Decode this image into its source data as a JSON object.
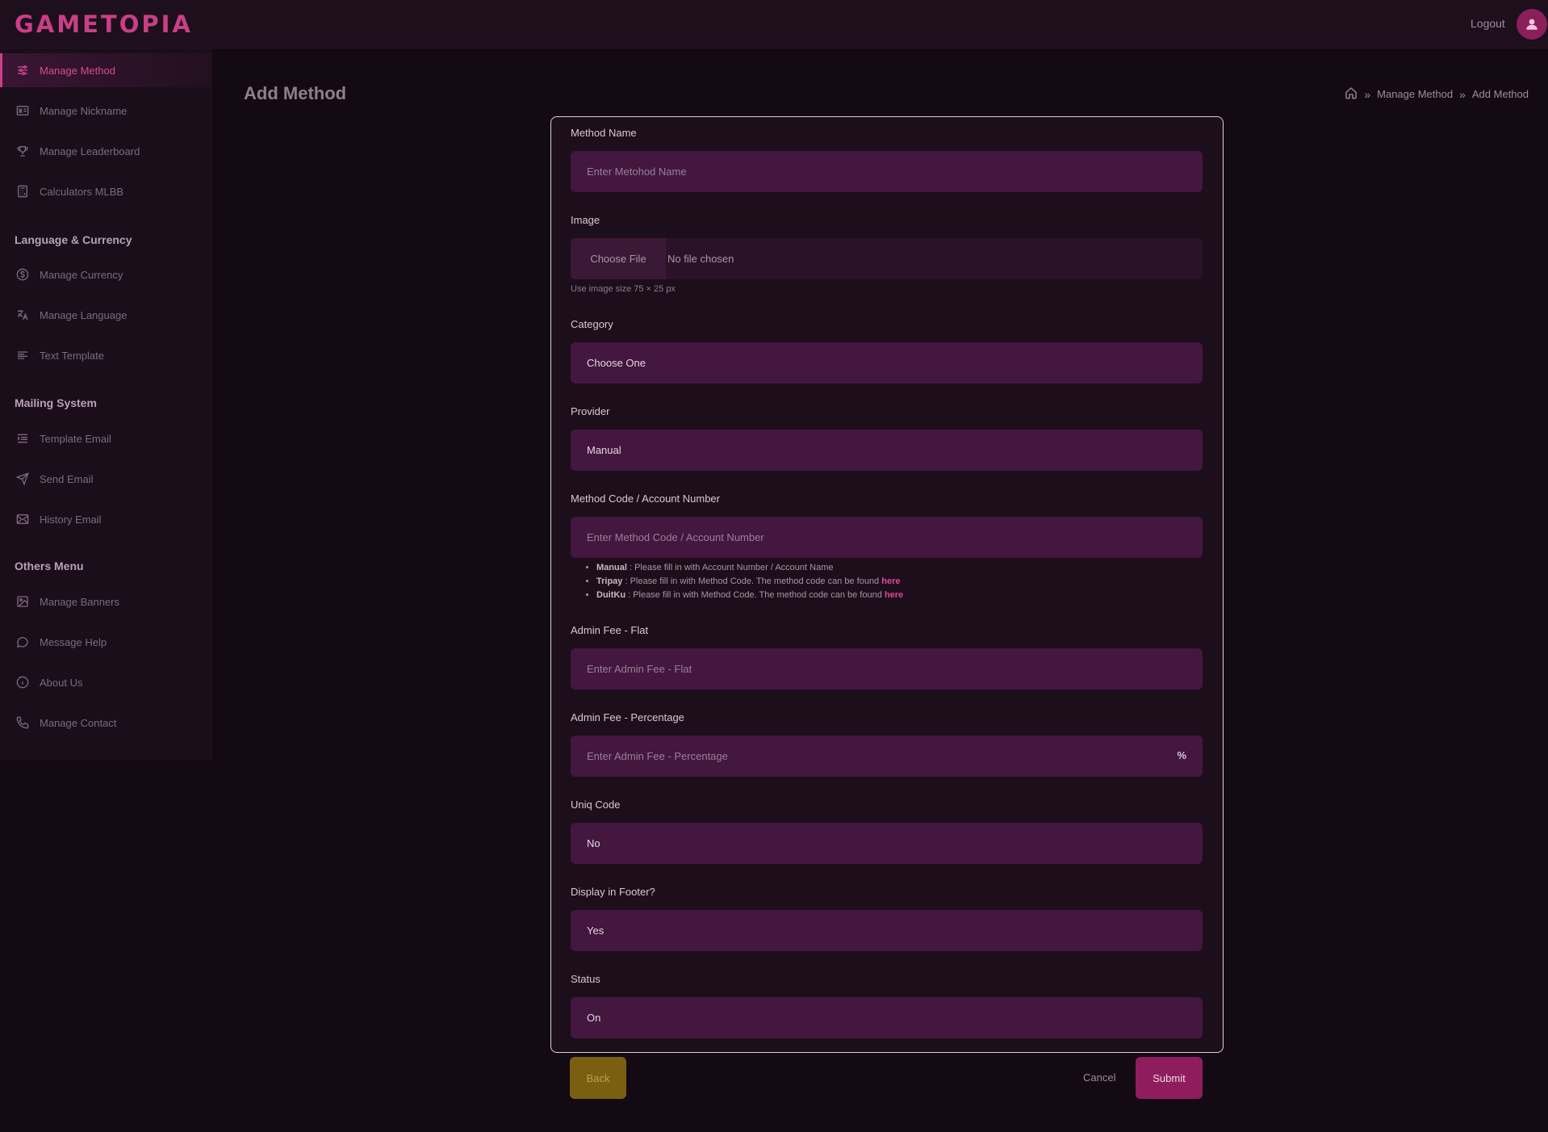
{
  "app": {
    "logo": "GAMETOPIA",
    "logout_label": "Logout"
  },
  "sidebar": {
    "items": [
      {
        "label": "Manage Method",
        "icon": "sliders-icon",
        "active": true
      },
      {
        "label": "Manage Nickname",
        "icon": "id-card-icon"
      },
      {
        "label": "Manage Leaderboard",
        "icon": "trophy-icon"
      },
      {
        "label": "Calculators MLBB",
        "icon": "calculator-icon"
      }
    ],
    "sections": [
      {
        "title": "Language & Currency",
        "items": [
          {
            "label": "Manage Currency",
            "icon": "dollar-circle-icon"
          },
          {
            "label": "Manage Language",
            "icon": "translate-icon"
          },
          {
            "label": "Text Template",
            "icon": "align-left-icon"
          }
        ]
      },
      {
        "title": "Mailing System",
        "items": [
          {
            "label": "Template Email",
            "icon": "list-indent-icon"
          },
          {
            "label": "Send Email",
            "icon": "send-icon"
          },
          {
            "label": "History Email",
            "icon": "envelope-icon"
          }
        ]
      },
      {
        "title": "Others Menu",
        "items": [
          {
            "label": "Manage Banners",
            "icon": "image-icon"
          },
          {
            "label": "Message Help",
            "icon": "chat-icon"
          },
          {
            "label": "About Us",
            "icon": "info-icon"
          },
          {
            "label": "Manage Contact",
            "icon": "phone-icon"
          }
        ]
      }
    ]
  },
  "page": {
    "title": "Add Method",
    "breadcrumb": [
      "Manage Method",
      "Add Method"
    ]
  },
  "form": {
    "method_name": {
      "label": "Method Name",
      "placeholder": "Enter Metohod Name"
    },
    "image": {
      "label": "Image",
      "button": "Choose File",
      "status": "No file chosen",
      "hint": "Use image size 75 × 25 px"
    },
    "category": {
      "label": "Category",
      "value": "Choose One"
    },
    "provider": {
      "label": "Provider",
      "value": "Manual"
    },
    "method_code": {
      "label": "Method Code / Account Number",
      "placeholder": "Enter Method Code / Account Number"
    },
    "notes": [
      {
        "name": "Manual",
        "text": " : Please fill in with Account Number / Account Name",
        "link": ""
      },
      {
        "name": "Tripay",
        "text": " : Please fill in with Method Code. The method code can be found ",
        "link": "here"
      },
      {
        "name": "DuitKu",
        "text": " : Please fill in with Method Code. The method code can be found ",
        "link": "here"
      }
    ],
    "admin_fee_flat": {
      "label": "Admin Fee - Flat",
      "placeholder": "Enter Admin Fee - Flat"
    },
    "admin_fee_percentage": {
      "label": "Admin Fee - Percentage",
      "placeholder": "Enter Admin Fee - Percentage",
      "suffix": "%"
    },
    "uniq_code": {
      "label": "Uniq Code",
      "value": "No"
    },
    "display_footer": {
      "label": "Display in Footer?",
      "value": "Yes"
    },
    "status": {
      "label": "Status",
      "value": "On"
    }
  },
  "actions": {
    "back": "Back",
    "cancel": "Cancel",
    "submit": "Submit"
  },
  "colors": {
    "accent": "#c93f87",
    "field_bg": "#43173f",
    "back_button": "#7a5f10",
    "submit_button": "#8f1d5d"
  }
}
